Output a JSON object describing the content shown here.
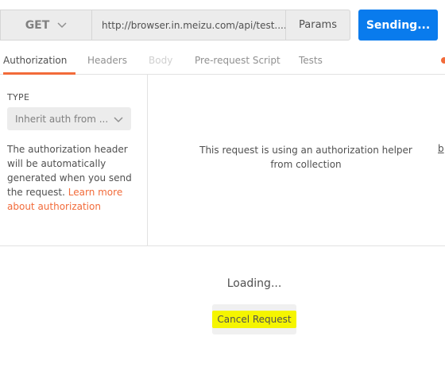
{
  "request": {
    "method": "GET",
    "url": "http://browser.in.meizu.com/api/test....",
    "params_label": "Params",
    "send_label": "Sending..."
  },
  "tabs": [
    {
      "label": "Authorization",
      "active": true
    },
    {
      "label": "Headers"
    },
    {
      "label": "Body",
      "disabled": true
    },
    {
      "label": "Pre-request Script"
    },
    {
      "label": "Tests"
    }
  ],
  "auth": {
    "type_label": "TYPE",
    "type_value": "Inherit auth from ...",
    "description": "The authorization header will be automatically generated when you send the request. ",
    "learn_more": "Learn more about authorization",
    "helper_message": "This request is using an authorization helper from collection",
    "edge_link": "b"
  },
  "loading": {
    "text": "Loading...",
    "cancel_label": "Cancel Request"
  },
  "colors": {
    "accent": "#f26b3a",
    "send_button": "#097bed",
    "highlight": "#f5f500"
  }
}
